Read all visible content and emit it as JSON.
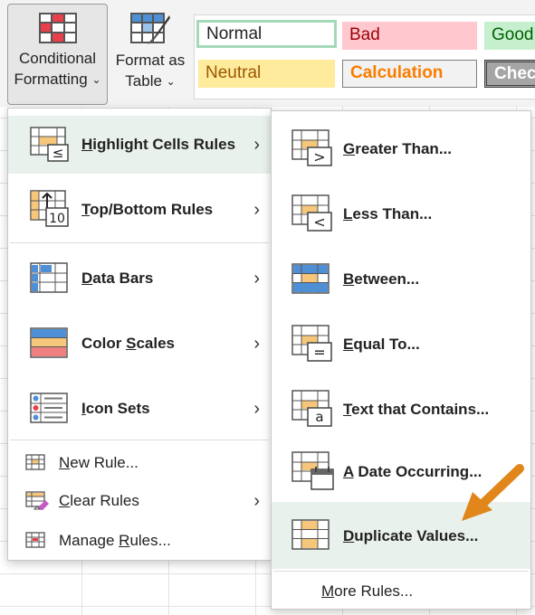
{
  "ribbon": {
    "conditional_formatting": {
      "line1": "Conditional",
      "line2": "Formatting",
      "caret": "⌄"
    },
    "format_as_table": {
      "line1": "Format as",
      "line2": "Table",
      "caret": "⌄"
    },
    "styles": [
      {
        "label": "Normal",
        "bg": "#ffffff",
        "color": "#000000"
      },
      {
        "label": "Bad",
        "bg": "#ffc7ce",
        "color": "#9c0006"
      },
      {
        "label": "Good",
        "bg": "#c6efce",
        "color": "#006100"
      },
      {
        "label": "Neutral",
        "bg": "#ffeb9c",
        "color": "#9c5700"
      },
      {
        "label": "Calculation",
        "bg": "#f2f2f2",
        "color": "#fa7d00"
      },
      {
        "label": "Check",
        "bg": "#a5a5a5",
        "color": "#ffffff"
      }
    ]
  },
  "main_menu": {
    "items": [
      {
        "pre": "",
        "u": "H",
        "post": "ighlight Cells Rules"
      },
      {
        "pre": "",
        "u": "T",
        "post": "op/Bottom Rules"
      },
      {
        "pre": "",
        "u": "D",
        "post": "ata Bars"
      },
      {
        "pre": "Color ",
        "u": "S",
        "post": "cales"
      },
      {
        "pre": "",
        "u": "I",
        "post": "con Sets"
      }
    ],
    "top_bottom_badge": "10",
    "bottom_items": [
      {
        "pre": "",
        "u": "N",
        "post": "ew Rule..."
      },
      {
        "pre": "",
        "u": "C",
        "post": "lear Rules"
      },
      {
        "pre": "Manage ",
        "u": "R",
        "post": "ules..."
      }
    ]
  },
  "submenu": {
    "items": [
      {
        "pre": "",
        "u": "G",
        "post": "reater Than...",
        "glyph": ">"
      },
      {
        "pre": "",
        "u": "L",
        "post": "ess Than...",
        "glyph": "<"
      },
      {
        "pre": "",
        "u": "B",
        "post": "etween...",
        "glyph": ""
      },
      {
        "pre": "",
        "u": "E",
        "post": "qual To...",
        "glyph": "="
      },
      {
        "pre": "",
        "u": "T",
        "post": "ext that Contains...",
        "glyph": "a"
      },
      {
        "pre": "",
        "u": "A",
        "post": " Date Occurring...",
        "glyph": ""
      },
      {
        "pre": "",
        "u": "D",
        "post": "uplicate Values...",
        "glyph": ""
      }
    ],
    "more": {
      "pre": "",
      "u": "M",
      "post": "ore Rules..."
    }
  },
  "colors": {
    "accent_arrow": "#e0861a",
    "highlight": "#e9f1ec",
    "grid_icon": "#555555",
    "icon_orange": "#f6c77a",
    "icon_blue": "#4f8fd6"
  }
}
